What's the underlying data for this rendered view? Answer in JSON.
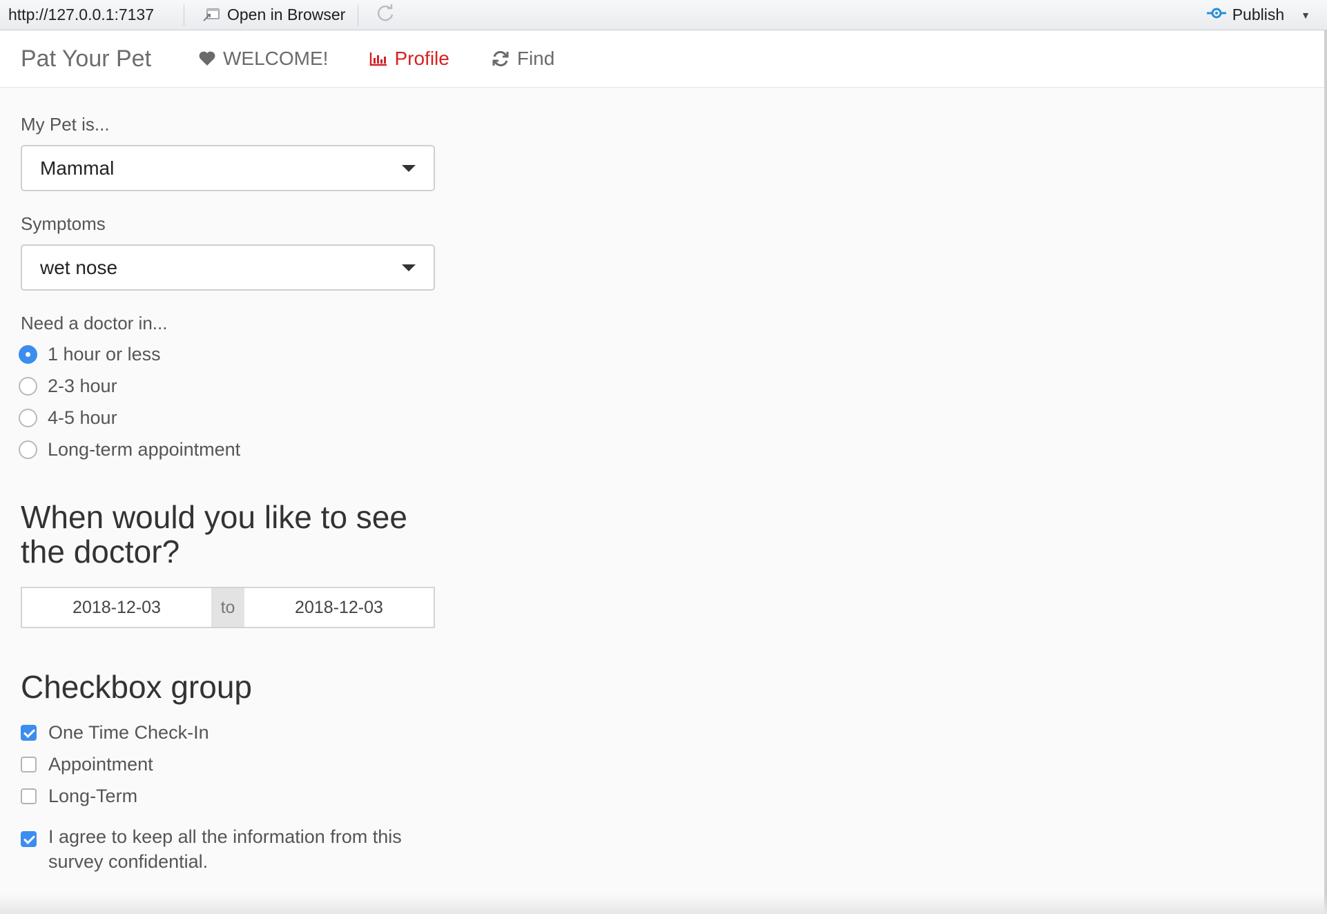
{
  "toolbar": {
    "url": "http://127.0.0.1:7137",
    "open_in_browser": "Open in Browser",
    "publish": "Publish"
  },
  "navbar": {
    "brand": "Pat Your Pet",
    "items": [
      {
        "label": "WELCOME!",
        "icon": "heart-icon",
        "active": false
      },
      {
        "label": "Profile",
        "icon": "bar-chart-icon",
        "active": true
      },
      {
        "label": "Find",
        "icon": "refresh-icon",
        "active": false
      }
    ]
  },
  "form": {
    "pet_label": "My Pet is...",
    "pet_value": "Mammal",
    "symptoms_label": "Symptoms",
    "symptoms_value": "wet nose",
    "doctor_label": "Need a doctor in...",
    "doctor_options": [
      "1 hour or less",
      "2-3 hour",
      "4-5 hour",
      "Long-term appointment"
    ],
    "doctor_selected": 0,
    "when_heading": "When would you like to see the doctor?",
    "date_start": "2018-12-03",
    "date_sep": "to",
    "date_end": "2018-12-03",
    "checkbox_heading": "Checkbox group",
    "checkboxes": [
      {
        "label": "One Time Check-In",
        "checked": true
      },
      {
        "label": "Appointment",
        "checked": false
      },
      {
        "label": "Long-Term",
        "checked": false
      }
    ],
    "agree_label": "I agree to keep all the information from this survey confidential.",
    "agree_checked": true
  },
  "colors": {
    "accent": "#3b8df0",
    "active_nav": "#d62121",
    "publish_icon": "#2a8fd6"
  }
}
